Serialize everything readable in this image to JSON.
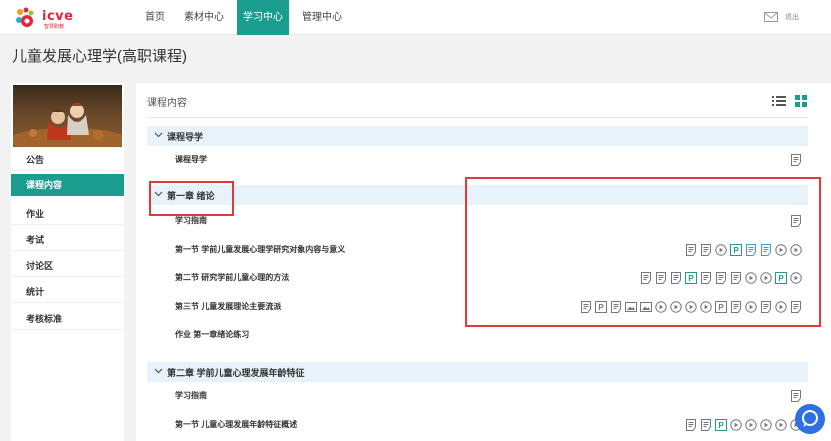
{
  "logo": {
    "text": "icve",
    "sub": "智慧职教"
  },
  "nav": {
    "items": [
      {
        "label": "首页",
        "active": false
      },
      {
        "label": "素材中心",
        "active": false
      },
      {
        "label": "学习中心",
        "active": true
      },
      {
        "label": "管理中心",
        "active": false
      }
    ],
    "logout": "退出"
  },
  "course": {
    "title": "儿童发展心理学(高职课程)"
  },
  "sidebar": {
    "items": [
      {
        "label": "公告",
        "active": false
      },
      {
        "label": "课程内容",
        "active": true
      },
      {
        "label": "作业",
        "active": false
      },
      {
        "label": "考试",
        "active": false
      },
      {
        "label": "讨论区",
        "active": false
      },
      {
        "label": "统计",
        "active": false
      },
      {
        "label": "考核标准",
        "active": false
      }
    ]
  },
  "main": {
    "header": "课程内容",
    "sections": [
      {
        "kind": "chapter",
        "label": "课程导学"
      },
      {
        "kind": "item",
        "label": "课程导学",
        "icons": [
          "doc"
        ]
      },
      {
        "kind": "chapter",
        "label": "第一章 绪论"
      },
      {
        "kind": "item",
        "label": "学习指南",
        "icons": [
          "doc"
        ]
      },
      {
        "kind": "item",
        "label": "第一节 学前儿童发展心理学研究对象内容与意义",
        "icons": [
          "doc",
          "doc",
          "video",
          "ppt",
          "doc-b",
          "doc-b",
          "video",
          "video"
        ]
      },
      {
        "kind": "item",
        "label": "第二节 研究学前儿童心理的方法",
        "icons": [
          "doc",
          "doc",
          "doc",
          "ppt",
          "doc",
          "doc",
          "doc",
          "video",
          "video",
          "ppt",
          "video"
        ]
      },
      {
        "kind": "item",
        "label": "第三节 儿童发展理论主要流派",
        "icons": [
          "doc",
          "p",
          "doc",
          "img",
          "img",
          "video",
          "video",
          "video",
          "video",
          "p",
          "doc",
          "video",
          "doc",
          "video",
          "doc"
        ]
      },
      {
        "kind": "item",
        "label": "作业 第一章绪论练习",
        "icons": []
      },
      {
        "kind": "chapter",
        "label": "第二章 学前儿童心理发展年龄特征"
      },
      {
        "kind": "item",
        "label": "学习指南",
        "icons": [
          "doc"
        ]
      },
      {
        "kind": "item",
        "label": "第一节 儿童心理发展年龄特征概述",
        "icons": [
          "doc",
          "doc",
          "ppt",
          "video",
          "video",
          "video",
          "video",
          "video"
        ]
      }
    ]
  },
  "colors": {
    "accent": "#1a9c8f",
    "highlight": "#e03a3a",
    "chapter_bg": "#e8f2fa",
    "ppt": "#1a9c8f",
    "doc_blue": "#3d9ad8"
  }
}
